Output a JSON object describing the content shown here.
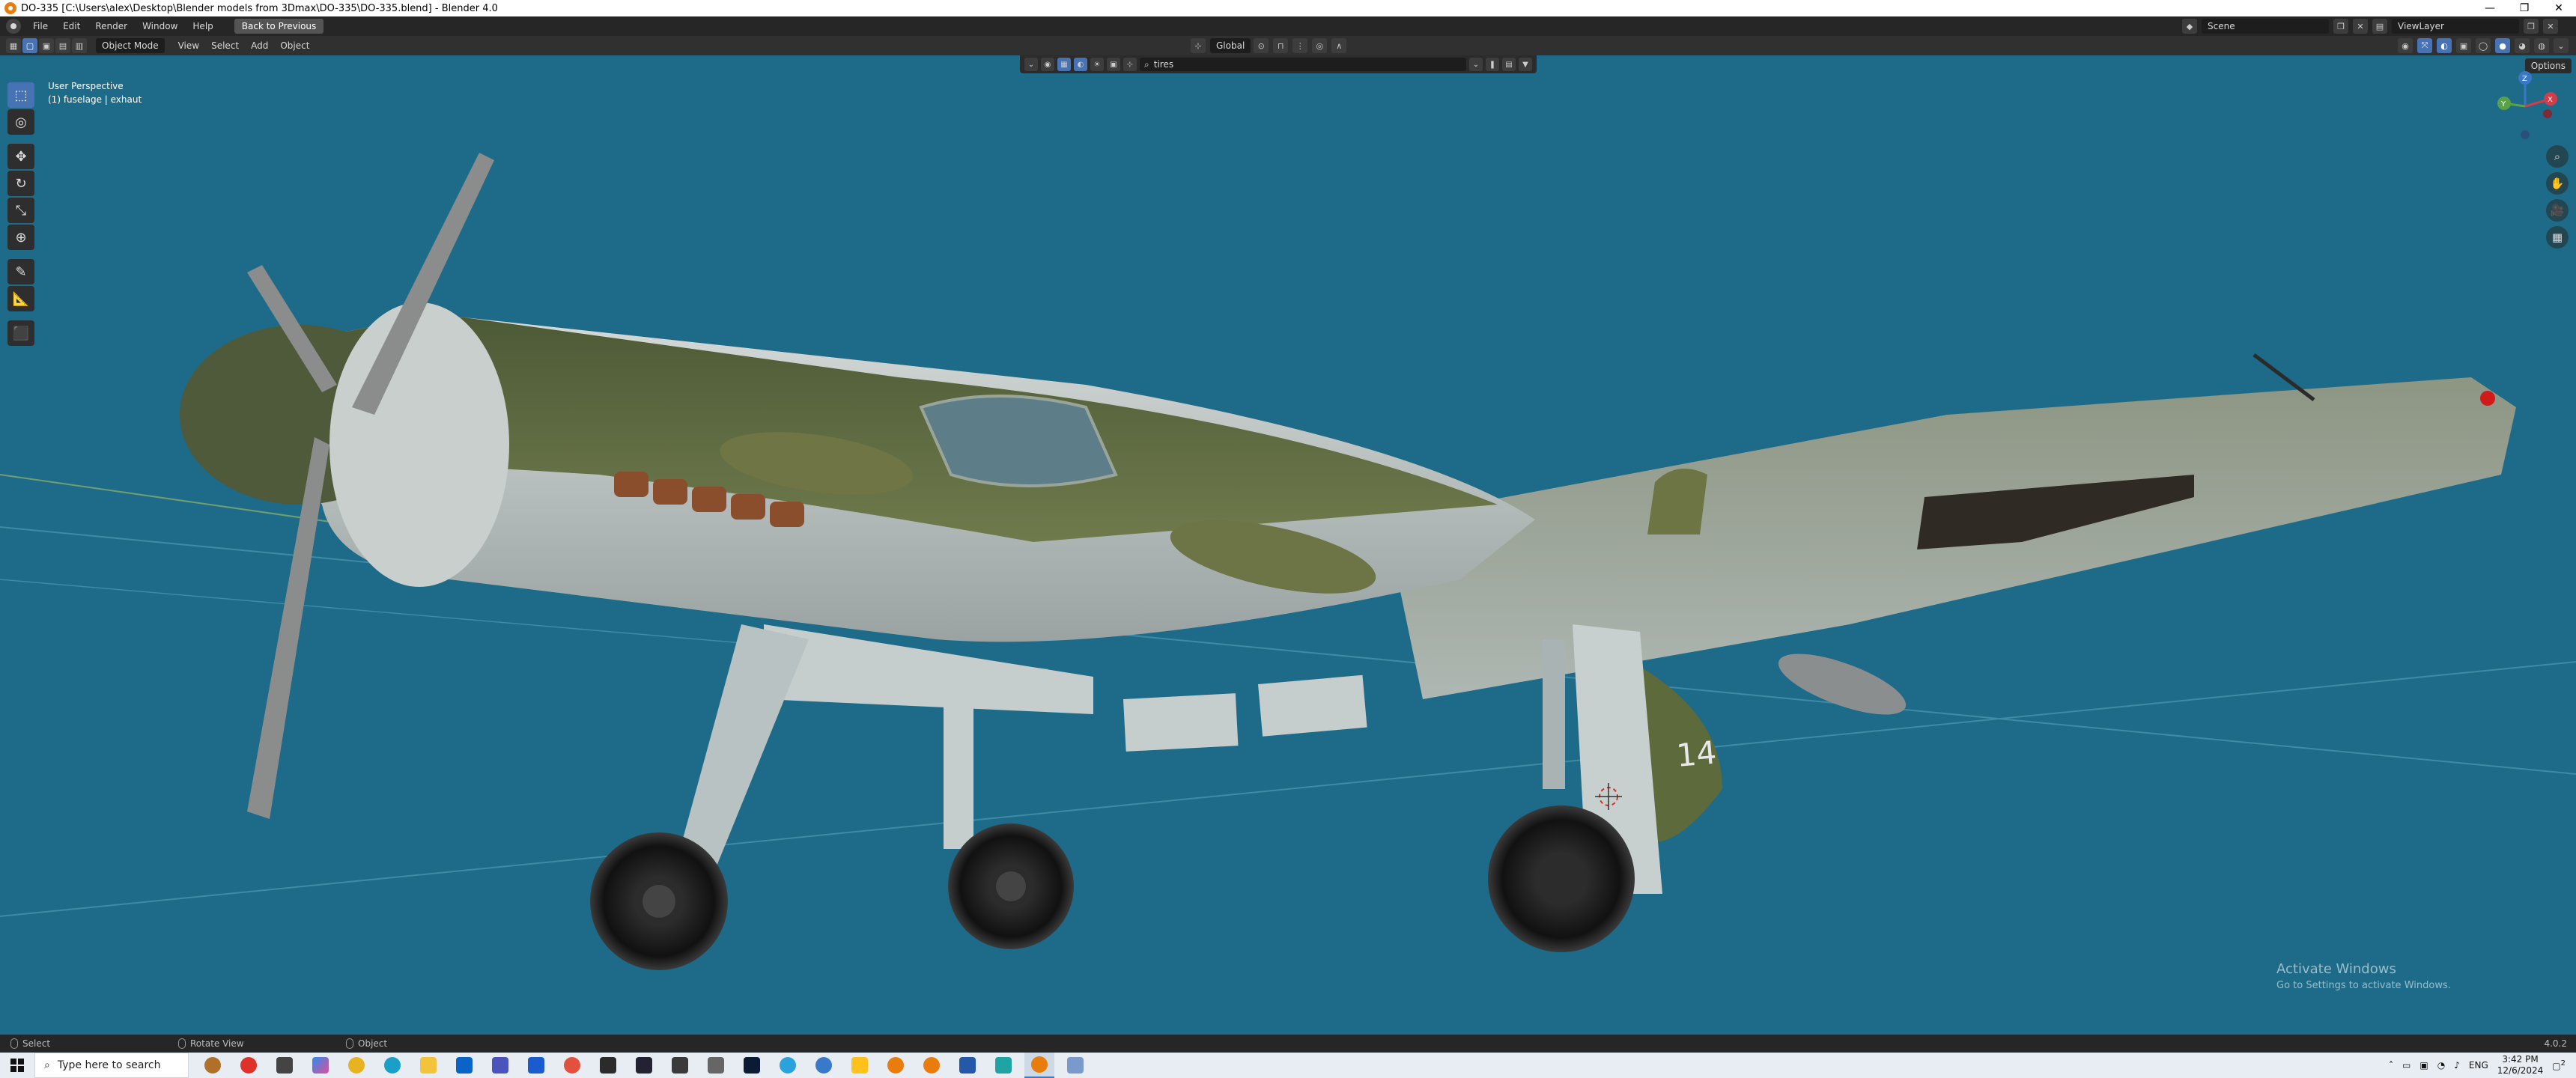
{
  "window": {
    "title": "DO-335 [C:\\Users\\alex\\Desktop\\Blender models from 3Dmax\\DO-335\\DO-335.blend] - Blender 4.0",
    "controls": [
      "—",
      "❐",
      "✕"
    ]
  },
  "topbar": {
    "menus": [
      "File",
      "Edit",
      "Render",
      "Window",
      "Help"
    ],
    "back_label": "Back to Previous",
    "scene": "Scene",
    "view_layer": "ViewLayer"
  },
  "viewport_header": {
    "mode": "Object Mode",
    "menus": [
      "View",
      "Select",
      "Add",
      "Object"
    ],
    "transform_orientation": "Global",
    "options_label": "Options"
  },
  "filter": {
    "search_value": "tires"
  },
  "viewport": {
    "perspective": "User Perspective",
    "active_object": "(1) fuselage | exhaut",
    "background_color": "#1d6b88",
    "tail_number": "14"
  },
  "toolbar": {
    "tools": [
      "select-box",
      "cursor",
      "move",
      "rotate",
      "scale",
      "transform",
      "annotate",
      "measure",
      "add-cube"
    ]
  },
  "gizmo": {
    "axes": [
      "X",
      "Y",
      "Z"
    ]
  },
  "activation": {
    "line1": "Activate Windows",
    "line2": "Go to Settings to activate Windows."
  },
  "statusbar": {
    "items": [
      "Select",
      "Rotate View",
      "Object"
    ],
    "version": "4.0.2"
  },
  "taskbar": {
    "search_placeholder": "Type here to search",
    "time": "3:42 PM",
    "date": "12/6/2024",
    "language": "ENG",
    "notification_count": "2"
  }
}
